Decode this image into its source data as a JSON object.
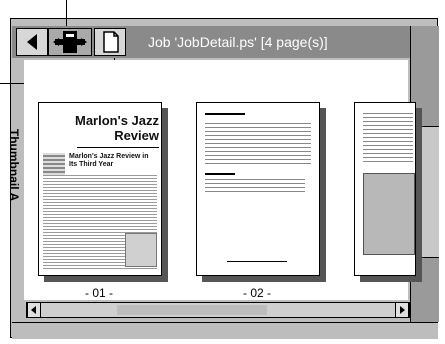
{
  "toolbar": {
    "job_title": "Job 'JobDetail.ps' [4 page(s)]"
  },
  "side_tab": {
    "label": "Thumbnail A"
  },
  "pages": [
    {
      "label": "- 01 -",
      "headline": "Marlon's Jazz Review",
      "subhead": "Marlon's Jazz Review in Its Third Year"
    },
    {
      "label": "- 02 -"
    },
    {
      "label": ""
    }
  ],
  "icons": {
    "back": "left-arrow-icon",
    "device": "printer-device-icon",
    "document": "document-icon"
  },
  "colors": {
    "toolbar_bg": "#8a8a8a",
    "panel_bg": "#bdbdbd",
    "content_bg": "#ffffff"
  }
}
